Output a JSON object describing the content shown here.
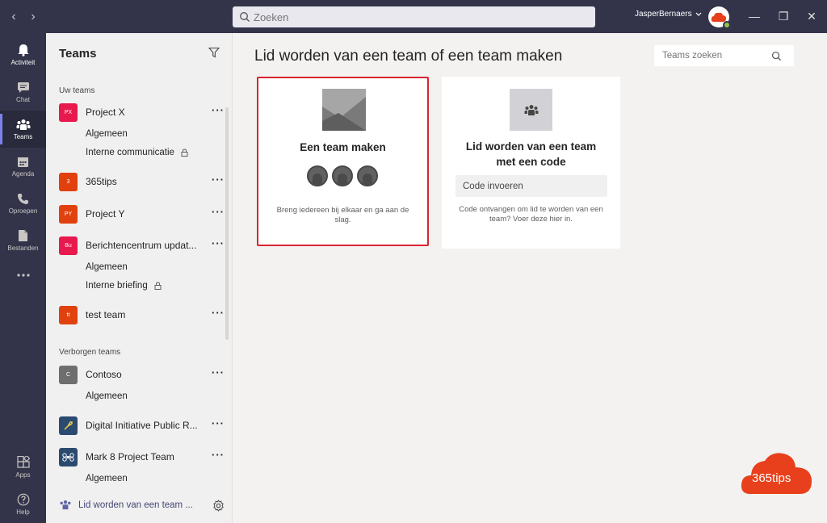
{
  "titlebar": {
    "search_placeholder": "Zoeken",
    "user_name": "JasperBernaers"
  },
  "rail": {
    "items": [
      {
        "label": "Activiteit",
        "icon": "bell-icon"
      },
      {
        "label": "Chat",
        "icon": "chat-icon"
      },
      {
        "label": "Teams",
        "icon": "teams-icon"
      },
      {
        "label": "Agenda",
        "icon": "calendar-icon"
      },
      {
        "label": "Oproepen",
        "icon": "phone-icon"
      },
      {
        "label": "Bestanden",
        "icon": "file-icon"
      },
      {
        "label": "Apps",
        "icon": "apps-icon"
      },
      {
        "label": "Help",
        "icon": "help-icon"
      }
    ]
  },
  "panel": {
    "title": "Teams",
    "section_your_teams": "Uw teams",
    "section_hidden_teams": "Verborgen teams",
    "teams": [
      {
        "name": "Project X",
        "initials": "PX",
        "color": "#e8194d"
      },
      {
        "name": "365tips",
        "initials": "3",
        "color": "#e1410e"
      },
      {
        "name": "Project Y",
        "initials": "PY",
        "color": "#e1410e"
      },
      {
        "name": "Berichtencentrum updat...",
        "initials": "Bu",
        "color": "#e8194d"
      },
      {
        "name": "test team",
        "initials": "tt",
        "color": "#e1410e"
      }
    ],
    "channels": {
      "project_x_general": "Algemeen",
      "project_x_internal": "Interne communicatie",
      "berichten_general": "Algemeen",
      "berichten_briefing": "Interne briefing"
    },
    "hidden_teams": [
      {
        "name": "Contoso",
        "initials": "C",
        "color": "#6e6e6e"
      },
      {
        "name": "Digital Initiative Public R...",
        "initials": "",
        "color": "#2b4a70"
      },
      {
        "name": "Mark 8 Project Team",
        "initials": "",
        "color": "#2b4a70"
      }
    ],
    "hidden_channels": {
      "contoso_general": "Algemeen",
      "mark8_general": "Algemeen"
    },
    "join_link": "Lid worden van een team ..."
  },
  "main": {
    "title": "Lid worden van een team of een team maken",
    "team_search_placeholder": "Teams zoeken",
    "create_card": {
      "title": "Een team maken",
      "description": "Breng iedereen bij elkaar en ga aan de slag."
    },
    "join_card": {
      "title": "Lid worden van een team met een code",
      "code_placeholder": "Code invoeren",
      "description": "Code ontvangen om lid te worden van een team? Voer deze hier in."
    }
  },
  "branding": {
    "text": "365tips",
    "color": "#e8401c"
  }
}
